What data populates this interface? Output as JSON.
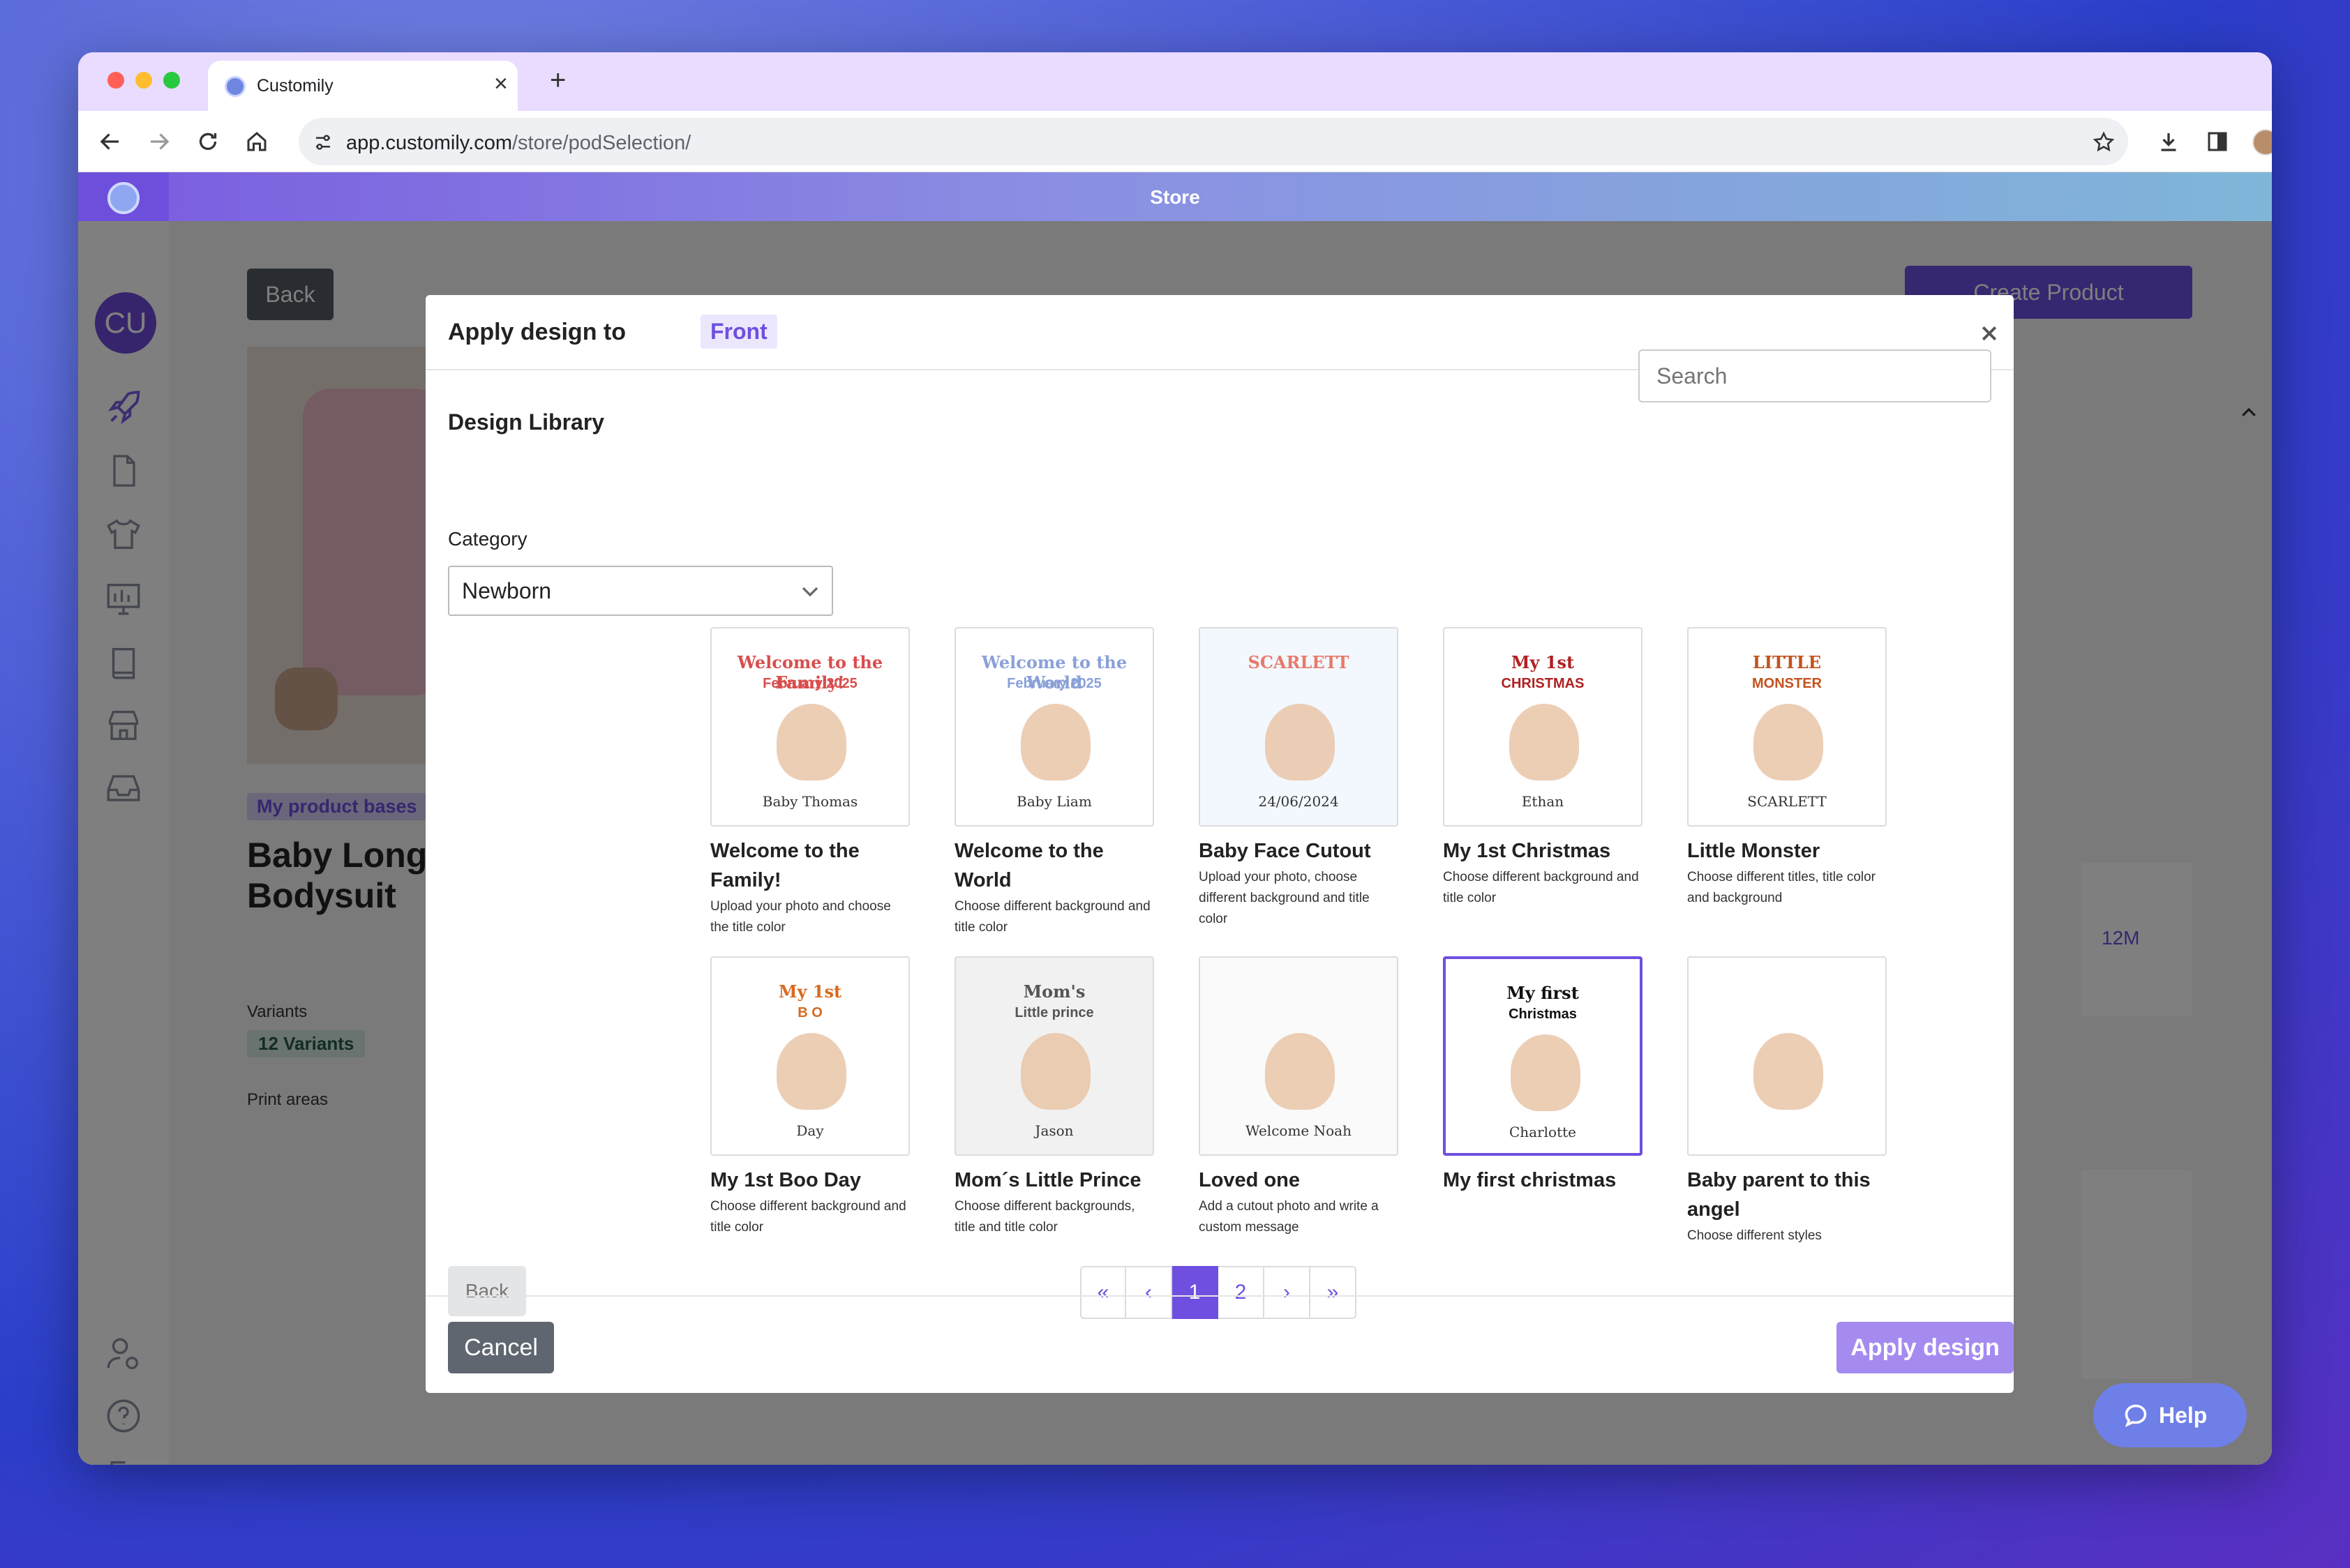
{
  "browser": {
    "tab_title": "Customily",
    "new_tab_symbol": "+",
    "close_tab_symbol": "×",
    "url_domain": "app.customily.com",
    "url_path": "/store/podSelection/"
  },
  "app": {
    "header_title": "Store",
    "avatar_initials": "CU",
    "sidebar_icons": [
      "rocket-icon",
      "file-icon",
      "tshirt-icon",
      "monitor-icon",
      "book-icon",
      "store-icon",
      "inbox-icon"
    ],
    "sidebar_bottom_icons": [
      "user-settings-icon",
      "help-circle-icon",
      "logout-icon"
    ]
  },
  "background_page": {
    "back_label": "Back",
    "create_product_label": "Create Product",
    "tag_label": "My product bases",
    "product_title_line1": "Baby Long",
    "product_title_line2": "Bodysuit",
    "variants_label": "Variants",
    "variants_badge": "12 Variants",
    "print_areas_label": "Print areas",
    "partial_text": "12M",
    "help_label": "Help"
  },
  "modal": {
    "title": "Apply design to",
    "title_badge": "Front",
    "section_title": "Design Library",
    "search_placeholder": "Search",
    "category_label": "Category",
    "category_value": "Newborn",
    "back_label": "Back",
    "cancel_label": "Cancel",
    "apply_label": "Apply design",
    "pagination": [
      "«",
      "‹",
      "1",
      "2",
      "›",
      "»"
    ],
    "current_page": "1",
    "designs": [
      {
        "name": "Welcome to the Family!",
        "desc": "Upload your photo and choose the title color",
        "thumb_title": "Welcome to the Family!",
        "thumb_sub": "February 2025",
        "thumb_foot": "Baby Thomas"
      },
      {
        "name": "Welcome to the World",
        "desc": "Choose different background and title color",
        "thumb_title": "Welcome to the World",
        "thumb_sub": "February 2025",
        "thumb_foot": "Baby Liam"
      },
      {
        "name": "Baby Face Cutout",
        "desc": "Upload your photo, choose different background and title color",
        "thumb_title": "SCARLETT",
        "thumb_sub": "",
        "thumb_foot": "24/06/2024"
      },
      {
        "name": "My 1st Christmas",
        "desc": "Choose different background and title color",
        "thumb_title": "My 1st",
        "thumb_sub": "CHRISTMAS",
        "thumb_foot": "Ethan"
      },
      {
        "name": "Little Monster",
        "desc": "Choose different titles, title color and background",
        "thumb_title": "LITTLE",
        "thumb_sub": "MONSTER",
        "thumb_foot": "SCARLETT"
      },
      {
        "name": "My 1st Boo Day",
        "desc": "Choose different background and title color",
        "thumb_title": "My 1st",
        "thumb_sub": "B  O",
        "thumb_foot": "Day"
      },
      {
        "name": "Mom´s Little Prince",
        "desc": "Choose different backgrounds, title and title color",
        "thumb_title": "Mom's",
        "thumb_sub": "Little prince",
        "thumb_foot": "Jason"
      },
      {
        "name": "Loved one",
        "desc": "Add a cutout photo and write a custom message",
        "thumb_title": "",
        "thumb_sub": "",
        "thumb_foot": "Welcome Noah"
      },
      {
        "name": "My first christmas",
        "desc": "",
        "thumb_title": "My first",
        "thumb_sub": "Christmas",
        "thumb_foot": "Charlotte"
      },
      {
        "name": "Baby parent to this angel",
        "desc": "Choose different styles",
        "thumb_title": "",
        "thumb_sub": "",
        "thumb_foot": ""
      }
    ]
  },
  "colors": {
    "accent": "#6f4fe0",
    "cancel_bg": "#5f6670",
    "apply_bg": "#a58bf0"
  }
}
